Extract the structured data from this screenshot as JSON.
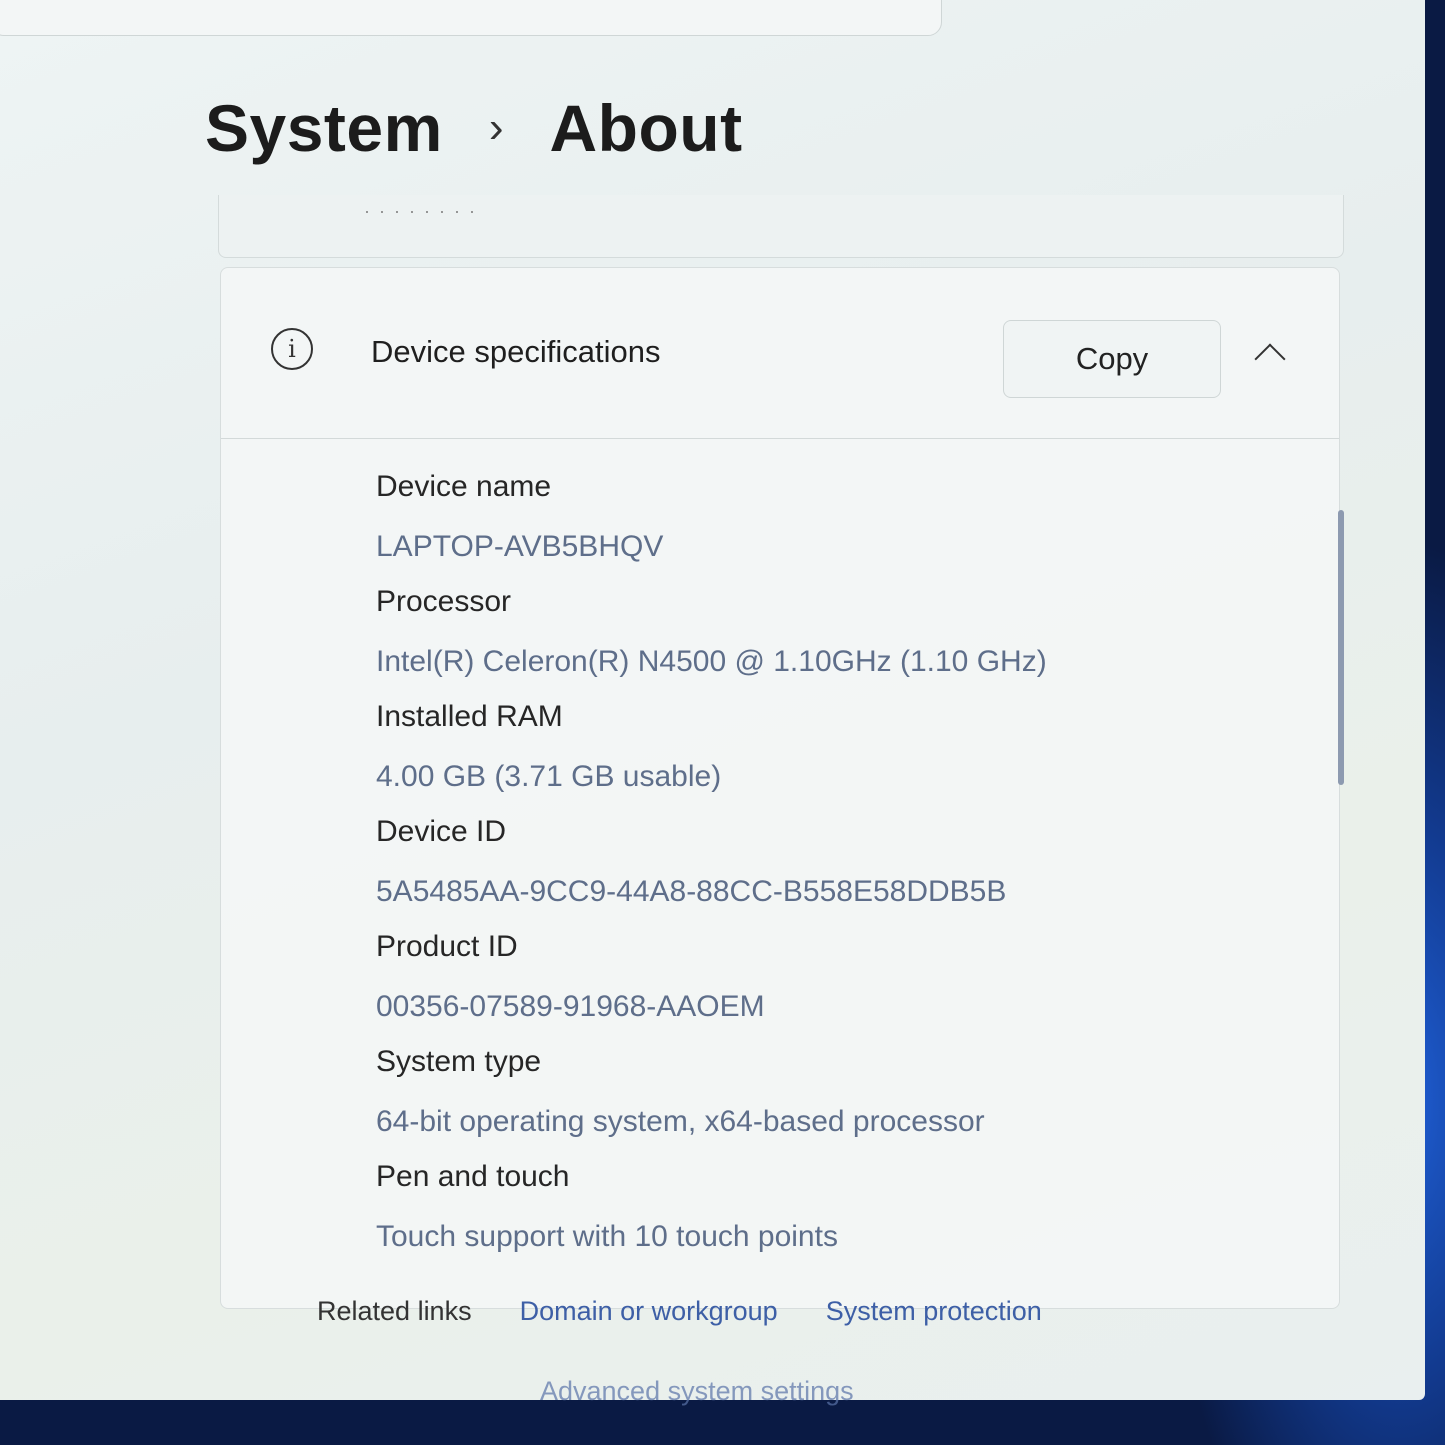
{
  "breadcrumb": {
    "parent": "System",
    "separator": "›",
    "current": "About"
  },
  "device_specifications": {
    "title": "Device specifications",
    "copy_label": "Copy",
    "items": [
      {
        "label": "Device name",
        "value": "LAPTOP-AVB5BHQV"
      },
      {
        "label": "Processor",
        "value": "Intel(R) Celeron(R) N4500 @ 1.10GHz (1.10 GHz)"
      },
      {
        "label": "Installed RAM",
        "value": "4.00 GB (3.71 GB usable)"
      },
      {
        "label": "Device ID",
        "value": "5A5485AA-9CC9-44A8-88CC-B558E58DDB5B"
      },
      {
        "label": "Product ID",
        "value": "00356-07589-91968-AAOEM"
      },
      {
        "label": "System type",
        "value": "64-bit operating system, x64-based processor"
      },
      {
        "label": "Pen and touch",
        "value": "Touch support with 10 touch points"
      }
    ]
  },
  "related_links": {
    "title": "Related links",
    "links": [
      "Domain or workgroup",
      "System protection",
      "Advanced system settings"
    ]
  },
  "icons": {
    "info": "info-icon",
    "collapse": "chevron-up-icon"
  }
}
